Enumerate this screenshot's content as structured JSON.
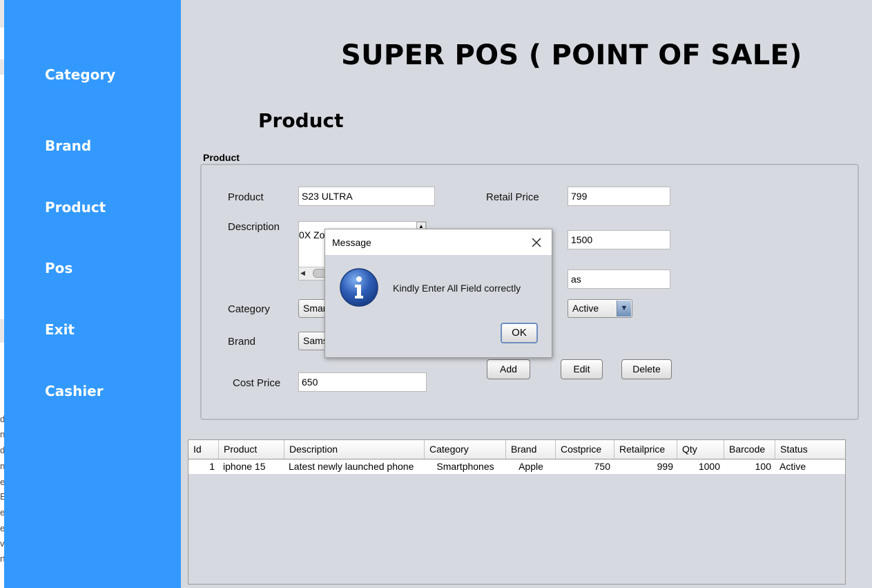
{
  "left_remnant": {
    "chars": [
      "d",
      "n",
      "d",
      "n",
      "e",
      "E",
      "e",
      "e",
      "v",
      "rt"
    ]
  },
  "sidebar": {
    "items": [
      {
        "label": "Category"
      },
      {
        "label": "Brand"
      },
      {
        "label": "Product"
      },
      {
        "label": "Pos"
      },
      {
        "label": "Exit"
      },
      {
        "label": "Cashier"
      }
    ]
  },
  "header": {
    "title": "SUPER POS ( POINT OF SALE)"
  },
  "section": {
    "title": "Product",
    "group_label": "Product"
  },
  "form": {
    "product_label": "Product",
    "product_value": "S23 ULTRA",
    "description_label": "Description",
    "description_value": "0X Zoo",
    "category_label": "Category",
    "category_value": "Smar",
    "brand_label": "Brand",
    "brand_value": "Sams",
    "cost_price_label": "Cost Price",
    "cost_price_value": "650",
    "retail_price_label": "Retail Price",
    "retail_price_value": "799",
    "qty_value": "1500",
    "barcode_value": "as",
    "status_value": "Active",
    "add_label": "Add",
    "edit_label": "Edit",
    "delete_label": "Delete"
  },
  "table": {
    "columns": [
      "Id",
      "Product",
      "Description",
      "Category",
      "Brand",
      "Costprice",
      "Retailprice",
      "Qty",
      "Barcode",
      "Status"
    ],
    "rows": [
      [
        "1",
        "iphone 15",
        "Latest newly launched phone",
        "Smartphones",
        "Apple",
        "750",
        "999",
        "1000",
        "100",
        "Active"
      ]
    ]
  },
  "dialog": {
    "title": "Message",
    "message": "Kindly Enter All Field correctly",
    "ok_label": "OK",
    "icon": "info-icon",
    "close_icon": "close-icon"
  },
  "colors": {
    "sidebar": "#3399ff",
    "background": "#d6d9df",
    "dialog_icon": "#2f5fb8"
  }
}
